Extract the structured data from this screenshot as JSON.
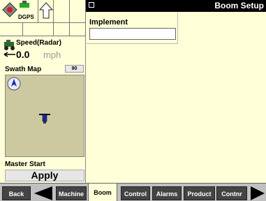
{
  "header": {
    "title": "Boom Setup"
  },
  "status": {
    "gps_label": "DGPS",
    "speed_label": "Speed(Radar)",
    "speed_value": "0.0",
    "speed_unit": "mph"
  },
  "swath": {
    "label": "Swath Map",
    "zoom_button": "90"
  },
  "master": {
    "label": "Master Start",
    "apply_label": "Apply"
  },
  "implement": {
    "label": "Implement",
    "value": ""
  },
  "nav": {
    "back": "Back",
    "tabs": [
      "Machine",
      "Boom",
      "Control",
      "Alarms",
      "Product",
      "Contnr"
    ],
    "active_tab": "Boom"
  },
  "colors": {
    "background": "#ffffd8",
    "header": "#000000",
    "tab_bg": "#444444"
  }
}
